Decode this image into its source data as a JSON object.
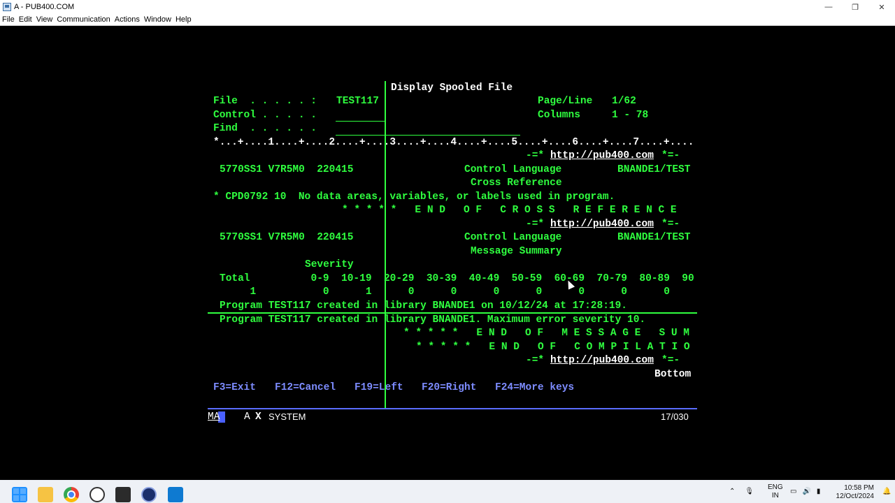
{
  "window": {
    "title": "A - PUB400.COM",
    "controls": [
      "—",
      "❐",
      "✕"
    ]
  },
  "menu": [
    "File",
    "Edit",
    "View",
    "Communication",
    "Actions",
    "Window",
    "Help"
  ],
  "screen": {
    "heading": "Display Spooled File",
    "file_label": "File  . . . . . :",
    "file_value": "TEST117",
    "control_label": "Control . . . . .",
    "find_label": "Find  . . . . . .",
    "pageline_label": "Page/Line",
    "pageline_value": "1/62",
    "columns_label": "Columns",
    "columns_value": "1 - 78",
    "ruler": "*...+....1....+....2....+....3....+....4....+....5....+....6....+....7....+....",
    "url_line1_prefix": "-=*",
    "url_line1_link": "http://pub400.com",
    "url_line1_suffix": "*=-",
    "line_5770_1": "5770SS1 V7R5M0  220415",
    "line_cl_1": "Control Language",
    "line_lib_1": "BNANDE1/TEST",
    "line_crossref": "Cross Reference",
    "line_cpd": "* CPD0792 10  No data areas, variables, or labels used in program.",
    "line_end_xref": "* * * * *   E N D   O F   C R O S S   R E F E R E N C E",
    "url_line2_link": "http://pub400.com",
    "line_5770_2": "5770SS1 V7R5M0  220415",
    "line_cl_2": "Control Language",
    "line_lib_2": "BNANDE1/TEST",
    "line_msgsum": "Message Summary",
    "severity_label": "Severity",
    "total_row": "Total          0-9  10-19  20-29  30-39  40-49  50-59  60-69  70-79  80-89  90",
    "count_row": "     1           0      1      0      0      0      0      0      0      0",
    "program_created": "Program TEST117 created in library BNANDE1 on 10/12/24 at 17:28:19.",
    "program_created2": "Program TEST117 created in library BNANDE1. Maximum error severity 10.",
    "end_msgsum": "* * * * *   E N D   O F   M E S S A G E   S U M",
    "end_compile": "* * * * *   E N D   O F   C O M P I L A T I O",
    "url_line3_link": "http://pub400.com",
    "bottom": "Bottom",
    "fkeys": {
      "f3": "F3=Exit",
      "f12": "F12=Cancel",
      "f19": "F19=Left",
      "f20": "F20=Right",
      "f24": "F24=More keys"
    }
  },
  "status_bar": {
    "ma": "MA",
    "a": "A",
    "x": "X",
    "system": "SYSTEM",
    "pos": "17/030"
  },
  "taskbar": {
    "icons": [
      "windows-start-icon",
      "file-explorer-icon",
      "chrome-icon",
      "obs-icon",
      "terminal-icon",
      "ibm-access-client-icon",
      "vscode-icon"
    ],
    "lang": "ENG",
    "region": "IN",
    "time": "10:58 PM",
    "date": "12/Oct/2024"
  }
}
